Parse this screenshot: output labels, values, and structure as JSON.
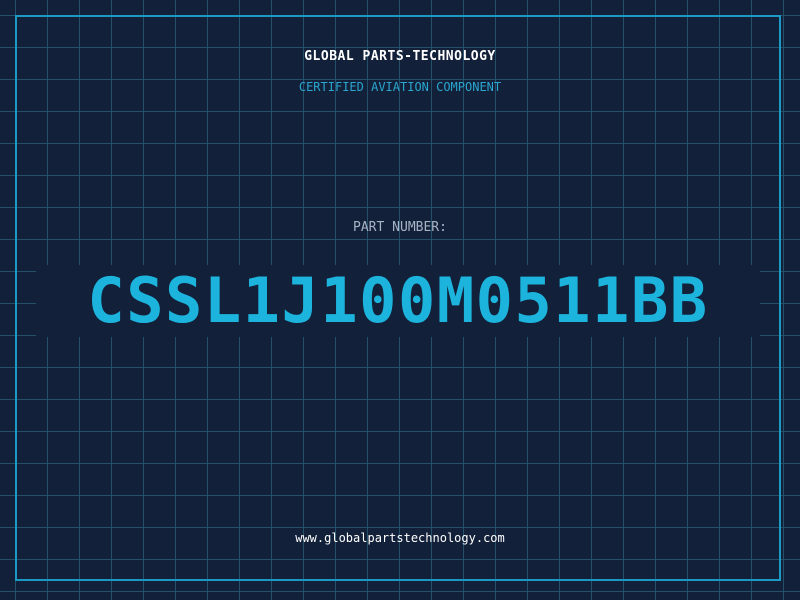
{
  "header": {
    "company": "GLOBAL PARTS-TECHNOLOGY",
    "tagline": "CERTIFIED AVIATION COMPONENT"
  },
  "part": {
    "label": "PART NUMBER:",
    "number": "CSSL1J100M0511BB"
  },
  "footer": {
    "website": "www.globalpartstechnology.com"
  },
  "colors": {
    "background": "#12203a",
    "grid": "#24506a",
    "frame": "#1d9ac4",
    "accent": "#1cb4dc",
    "label": "#a8b4c6",
    "text": "#ffffff"
  }
}
